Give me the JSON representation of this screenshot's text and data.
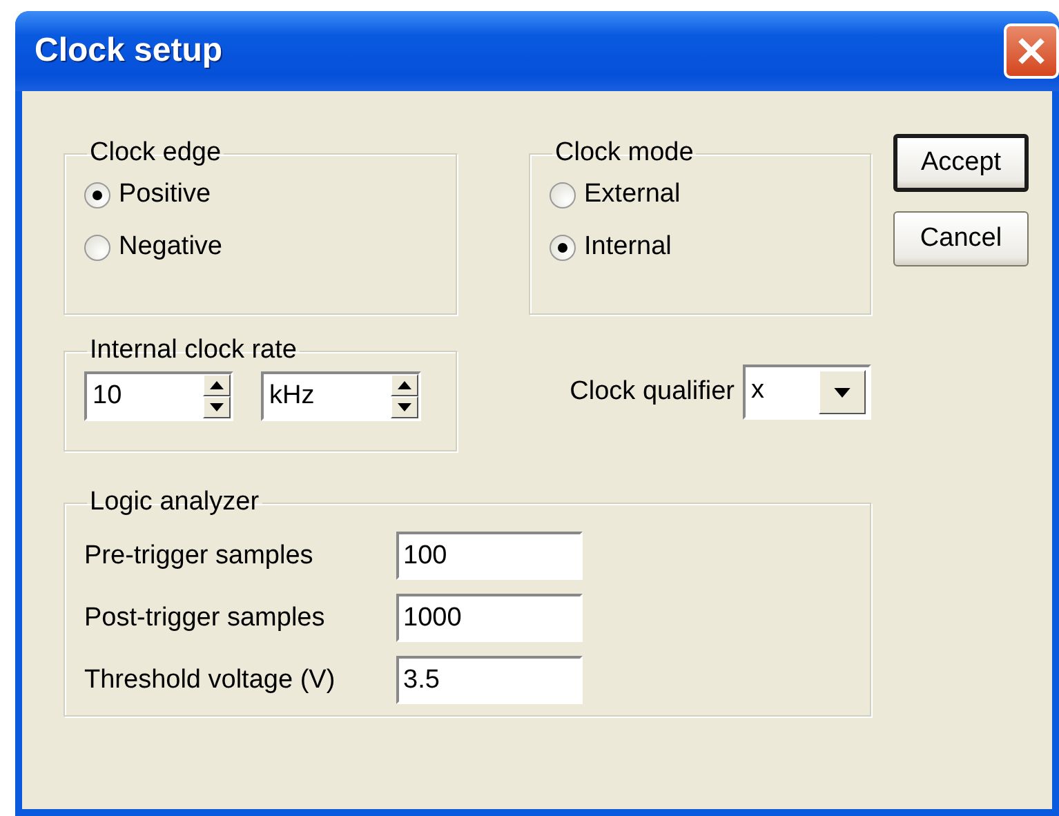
{
  "window": {
    "title": "Clock setup"
  },
  "clock_edge": {
    "title": "Clock edge",
    "options": [
      {
        "label": "Positive",
        "selected": true
      },
      {
        "label": "Negative",
        "selected": false
      }
    ]
  },
  "clock_mode": {
    "title": "Clock mode",
    "options": [
      {
        "label": "External",
        "selected": false
      },
      {
        "label": "Internal",
        "selected": true
      }
    ]
  },
  "buttons": [
    {
      "label": "Accept",
      "default": true
    },
    {
      "label": "Cancel",
      "default": false
    }
  ],
  "internal_clock_rate": {
    "title": "Internal clock rate",
    "value": "10",
    "unit": "kHz"
  },
  "clock_qualifier": {
    "label": "Clock qualifier",
    "value": "x"
  },
  "logic_analyzer": {
    "title": "Logic analyzer",
    "fields": [
      {
        "label": "Pre-trigger samples",
        "value": "100"
      },
      {
        "label": "Post-trigger samples",
        "value": "1000"
      },
      {
        "label": "Threshold voltage (V)",
        "value": "3.5"
      }
    ]
  }
}
